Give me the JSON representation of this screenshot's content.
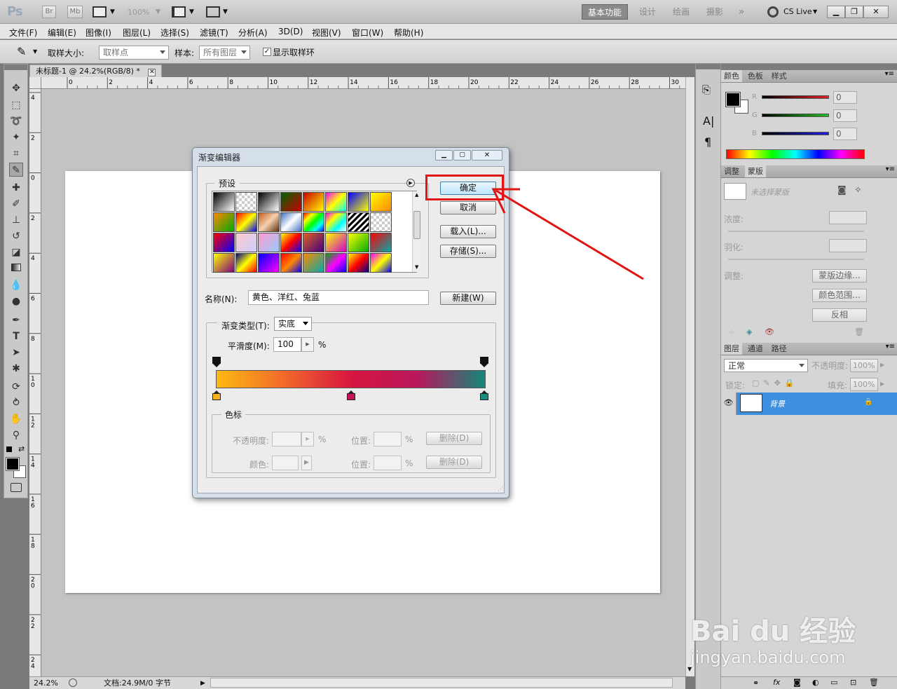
{
  "app": {
    "logo": "Ps",
    "br": "Br",
    "mb": "Mb",
    "zoom": "100%",
    "cs_live": "CS Live"
  },
  "workspaces": [
    "基本功能",
    "设计",
    "绘画",
    "摄影"
  ],
  "menu": [
    "文件(F)",
    "编辑(E)",
    "图像(I)",
    "图层(L)",
    "选择(S)",
    "滤镜(T)",
    "分析(A)",
    "3D(D)",
    "视图(V)",
    "窗口(W)",
    "帮助(H)"
  ],
  "options": {
    "sample_size_label": "取样大小:",
    "sample_size_value": "取样点",
    "sample_label": "样本:",
    "sample_value": "所有图层",
    "show_ring_label": "显示取样环",
    "show_ring_checked": true
  },
  "document": {
    "tab_title": "未标题-1 @ 24.2%(RGB/8) *",
    "ruler_h": [
      "0",
      "2",
      "4",
      "6",
      "8",
      "10",
      "12",
      "14",
      "16",
      "18",
      "20",
      "22",
      "24",
      "26",
      "28",
      "30"
    ],
    "ruler_v": [
      "4",
      "2",
      "0",
      "2",
      "4",
      "6",
      "8",
      "10",
      "12",
      "14",
      "16",
      "18",
      "20",
      "22",
      "24"
    ]
  },
  "status": {
    "zoom": "24.2%",
    "doc_info": "文档:24.9M/0 字节"
  },
  "color_panel": {
    "tabs": [
      "颜色",
      "色板",
      "样式"
    ],
    "channels": [
      {
        "label": "R",
        "value": "0",
        "color": "#e02020"
      },
      {
        "label": "G",
        "value": "0",
        "color": "#20c020"
      },
      {
        "label": "B",
        "value": "0",
        "color": "#2020e0"
      }
    ]
  },
  "masks_panel": {
    "tabs": [
      "调整",
      "蒙版"
    ],
    "no_mask": "未选择蒙版",
    "density": "浓度:",
    "feather": "羽化:",
    "refine": "调整:",
    "btn_edge": "蒙版边缘...",
    "btn_range": "颜色范围...",
    "btn_invert": "反相"
  },
  "layers_panel": {
    "tabs": [
      "图层",
      "通道",
      "路径"
    ],
    "blend": "正常",
    "opacity_label": "不透明度:",
    "opacity": "100%",
    "lock_label": "锁定:",
    "fill_label": "填充:",
    "fill": "100%",
    "layer_name": "背景"
  },
  "dialog": {
    "title": "渐变编辑器",
    "presets_label": "预设",
    "ok": "确定",
    "cancel": "取消",
    "load": "载入(L)...",
    "save": "存储(S)...",
    "name_label": "名称(N):",
    "name_value": "黄色、洋红、兔蓝",
    "new_btn": "新建(W)",
    "type_label": "渐变类型(T):",
    "type_value": "实底",
    "smooth_label": "平滑度(M):",
    "smooth_value": "100",
    "percent": "%",
    "stops_group": "色标",
    "opacity_label": "不透明度:",
    "location_label": "位置:",
    "delete_btn": "删除(D)",
    "color_label": "颜色:",
    "gradient_colors": [
      "#fdb913",
      "#f26a2b",
      "#d8153f",
      "#b8185c",
      "#13877a"
    ],
    "color_stop_colors": [
      "#f7b21a",
      "#c8125a",
      "#16907c"
    ]
  },
  "watermark": {
    "brand": "Bai du 经验",
    "url": "jingyan.baidu.com"
  }
}
